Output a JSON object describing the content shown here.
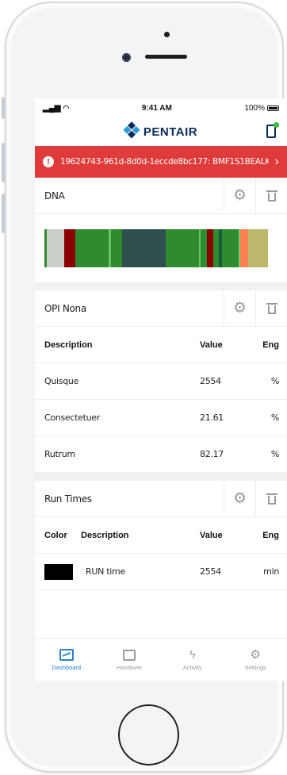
{
  "status_bar": {
    "time": "9:41 AM",
    "battery": "100%"
  },
  "header": {
    "brand": "PENTAIR"
  },
  "alert": {
    "text": "19624743-961d-8d0d-1eccde8bc177: BMF1S1BEALK",
    "icon": "exclamation-icon",
    "color": "#e03b3b"
  },
  "dna": {
    "title": "DNA",
    "segments": [
      {
        "color": "#2e8b2e",
        "pct": 1.0
      },
      {
        "color": "#c9cfc9",
        "pct": 7.5
      },
      {
        "color": "#8b0000",
        "pct": 4.6
      },
      {
        "color": "#2e8b2e",
        "pct": 14.2
      },
      {
        "color": "#66c466",
        "pct": 1.0
      },
      {
        "color": "#2e8b2e",
        "pct": 4.6
      },
      {
        "color": "#2f4f4f",
        "pct": 18.4
      },
      {
        "color": "#2e8b2e",
        "pct": 14.2
      },
      {
        "color": "#66c466",
        "pct": 0.8
      },
      {
        "color": "#2e8b2e",
        "pct": 2.5
      },
      {
        "color": "#8b0000",
        "pct": 2.8
      },
      {
        "color": "#2e8b2e",
        "pct": 2.5
      },
      {
        "color": "#1a5a3a",
        "pct": 1.2
      },
      {
        "color": "#2e8b2e",
        "pct": 7.0
      },
      {
        "color": "#7ac97a",
        "pct": 0.8
      },
      {
        "color": "#ff7f50",
        "pct": 3.2
      },
      {
        "color": "#bdb76b",
        "pct": 8.5
      }
    ]
  },
  "opi": {
    "title": "OPI Nona",
    "columns": {
      "desc": "Description",
      "value": "Value",
      "eng": "Eng"
    },
    "rows": [
      {
        "desc": "Quisque",
        "value": "2554",
        "eng": "%"
      },
      {
        "desc": "Consectetuer",
        "value": "21.61",
        "eng": "%"
      },
      {
        "desc": "Rutrum",
        "value": "82.17",
        "eng": "%"
      }
    ]
  },
  "run_times": {
    "title": "Run Times",
    "columns": {
      "color": "Color",
      "desc": "Description",
      "value": "Value",
      "eng": "Eng"
    },
    "rows": [
      {
        "color": "#000000",
        "desc": "RUN time",
        "value": "2554",
        "eng": "min"
      }
    ]
  },
  "tabs": [
    {
      "label": "Dashboard",
      "icon": "dashboard-icon",
      "active": true
    },
    {
      "label": "Handover",
      "icon": "handover-icon",
      "active": false
    },
    {
      "label": "Activity",
      "icon": "activity-icon",
      "active": false
    },
    {
      "label": "Settings",
      "icon": "settings-icon",
      "active": false
    }
  ]
}
